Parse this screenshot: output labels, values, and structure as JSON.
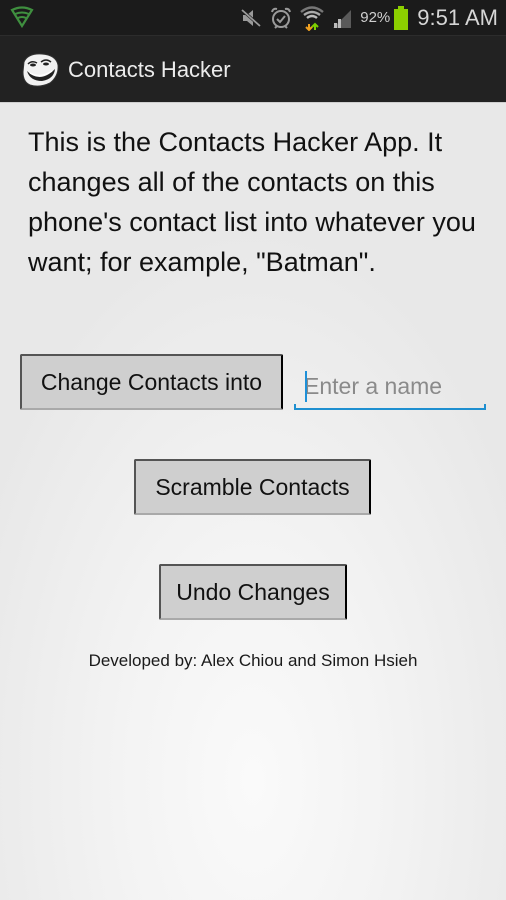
{
  "status_bar": {
    "left_icon": "shield-wifi-icon",
    "icons": [
      "mute-icon",
      "alarm-icon",
      "wifi-data-icon",
      "signal-icon"
    ],
    "battery_percent": "92%",
    "battery_level": 0.92,
    "time": "9:51 AM",
    "colors": {
      "shield": "#3f8f3f",
      "battery": "#8ccf00",
      "up_arrow": "#7ccf00",
      "down_arrow": "#f0a020"
    }
  },
  "action_bar": {
    "app_icon": "trollface-icon",
    "title": "Contacts Hacker"
  },
  "main": {
    "intro_text": "This is the Contacts Hacker App. It changes all of the contacts on this phone's contact list into whatever you want; for example, \"Batman\".",
    "change_button_label": "Change Contacts into",
    "name_input": {
      "value": "",
      "placeholder": "Enter a name"
    },
    "scramble_button_label": "Scramble Contacts",
    "undo_button_label": "Undo Changes",
    "credits": "Developed by: Alex Chiou and Simon Hsieh",
    "accent_color": "#1e8fd0"
  }
}
